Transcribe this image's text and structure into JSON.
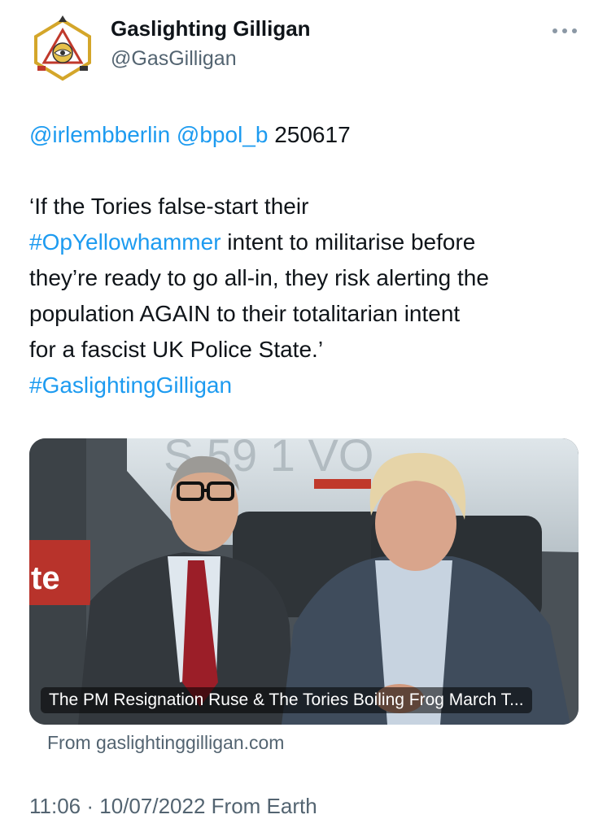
{
  "author": {
    "name": "Gaslighting Gilligan",
    "handle": "@GasGilligan"
  },
  "tweet": {
    "mention_1": "@irlembberlin",
    "mention_2": "@bpol_b",
    "ref_code": "250617",
    "line_1": "‘If the Tories false-start their",
    "hashtag_op": "#OpYellowhammer",
    "line_2_rest": " intent to militarise before",
    "line_3": "they’re ready to go all-in, they risk alerting the",
    "line_4": "population AGAIN to their totalitarian intent",
    "line_5": "for a fascist UK Police State.’",
    "hashtag_gg": "#GaslightingGilligan"
  },
  "link_card": {
    "caption": "The PM Resignation Ruse & The Tories Boiling Frog March T...",
    "source": "From gaslightinggilligan.com",
    "sign_text": "te"
  },
  "footer": {
    "time": "11:06",
    "separator": "·",
    "date": "10/07/2022",
    "client": "From Earth"
  },
  "colors": {
    "link": "#1d9bf0",
    "secondary_text": "#536471"
  }
}
